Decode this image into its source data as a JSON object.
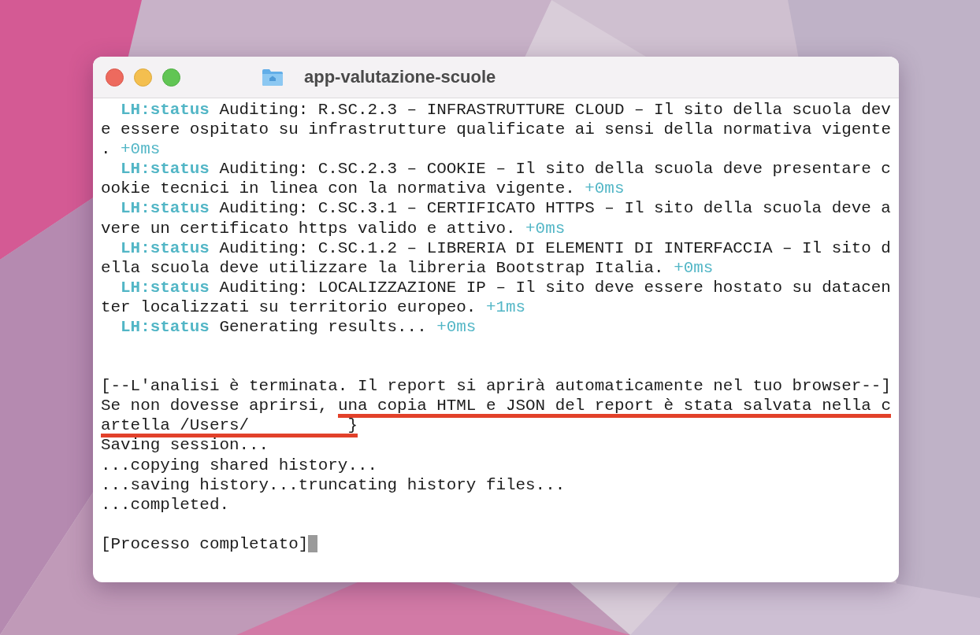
{
  "window": {
    "title": "app-valutazione-scuole"
  },
  "terminal": {
    "blocks": [
      {
        "lines": [
          {
            "indent": true,
            "parts": [
              {
                "kind": "tag",
                "text": "LH:status"
              },
              {
                "kind": "plain",
                "text": " Auditing: R.SC.2.3 – INFRASTRUTTURE CLOUD – Il sito della scuola dev"
              }
            ]
          },
          {
            "indent": false,
            "parts": [
              {
                "kind": "plain",
                "text": "e essere ospitato su infrastrutture qualificate ai sensi della normativa vigente"
              }
            ]
          },
          {
            "indent": false,
            "parts": [
              {
                "kind": "plain",
                "text": ". "
              },
              {
                "kind": "time",
                "text": "+0ms"
              }
            ]
          },
          {
            "indent": true,
            "parts": [
              {
                "kind": "tag",
                "text": "LH:status"
              },
              {
                "kind": "plain",
                "text": " Auditing: C.SC.2.3 – COOKIE – Il sito della scuola deve presentare c"
              }
            ]
          },
          {
            "indent": false,
            "parts": [
              {
                "kind": "plain",
                "text": "ookie tecnici in linea con la normativa vigente. "
              },
              {
                "kind": "time",
                "text": "+0ms"
              }
            ]
          },
          {
            "indent": true,
            "parts": [
              {
                "kind": "tag",
                "text": "LH:status"
              },
              {
                "kind": "plain",
                "text": " Auditing: C.SC.3.1 – CERTIFICATO HTTPS – Il sito della scuola deve a"
              }
            ]
          },
          {
            "indent": false,
            "parts": [
              {
                "kind": "plain",
                "text": "vere un certificato https valido e attivo. "
              },
              {
                "kind": "time",
                "text": "+0ms"
              }
            ]
          },
          {
            "indent": true,
            "parts": [
              {
                "kind": "tag",
                "text": "LH:status"
              },
              {
                "kind": "plain",
                "text": " Auditing: C.SC.1.2 – LIBRERIA DI ELEMENTI DI INTERFACCIA – Il sito d"
              }
            ]
          },
          {
            "indent": false,
            "parts": [
              {
                "kind": "plain",
                "text": "ella scuola deve utilizzare la libreria Bootstrap Italia. "
              },
              {
                "kind": "time",
                "text": "+0ms"
              }
            ]
          },
          {
            "indent": true,
            "parts": [
              {
                "kind": "tag",
                "text": "LH:status"
              },
              {
                "kind": "plain",
                "text": " Auditing: LOCALIZZAZIONE IP – Il sito deve essere hostato su datacen"
              }
            ]
          },
          {
            "indent": false,
            "parts": [
              {
                "kind": "plain",
                "text": "ter localizzati su territorio europeo. "
              },
              {
                "kind": "time",
                "text": "+1ms"
              }
            ]
          },
          {
            "indent": true,
            "parts": [
              {
                "kind": "tag",
                "text": "LH:status"
              },
              {
                "kind": "plain",
                "text": " Generating results... "
              },
              {
                "kind": "time",
                "text": "+0ms"
              }
            ]
          }
        ]
      },
      {
        "lines": [
          {
            "indent": false,
            "parts": [
              {
                "kind": "plain",
                "text": "[--L'analisi è terminata. Il report si aprirà automaticamente nel tuo browser--]"
              }
            ]
          },
          {
            "indent": false,
            "parts": [
              {
                "kind": "plain",
                "text": "Se non dovesse aprirsi, "
              },
              {
                "kind": "plain",
                "marked": true,
                "text": "una copia HTML e JSON del report è stata salvata nella c"
              }
            ]
          },
          {
            "indent": false,
            "parts": [
              {
                "kind": "plain",
                "marked": true,
                "text": "artella /Users/          }"
              }
            ]
          },
          {
            "indent": false,
            "parts": [
              {
                "kind": "plain",
                "text": "Saving session..."
              }
            ]
          },
          {
            "indent": false,
            "parts": [
              {
                "kind": "plain",
                "text": "...copying shared history..."
              }
            ]
          },
          {
            "indent": false,
            "parts": [
              {
                "kind": "plain",
                "text": "...saving history...truncating history files..."
              }
            ]
          },
          {
            "indent": false,
            "parts": [
              {
                "kind": "plain",
                "text": "...completed."
              }
            ]
          }
        ]
      },
      {
        "lines": [
          {
            "indent": false,
            "parts": [
              {
                "kind": "plain",
                "text": "[Processo completato]"
              }
            ]
          }
        ]
      }
    ]
  }
}
